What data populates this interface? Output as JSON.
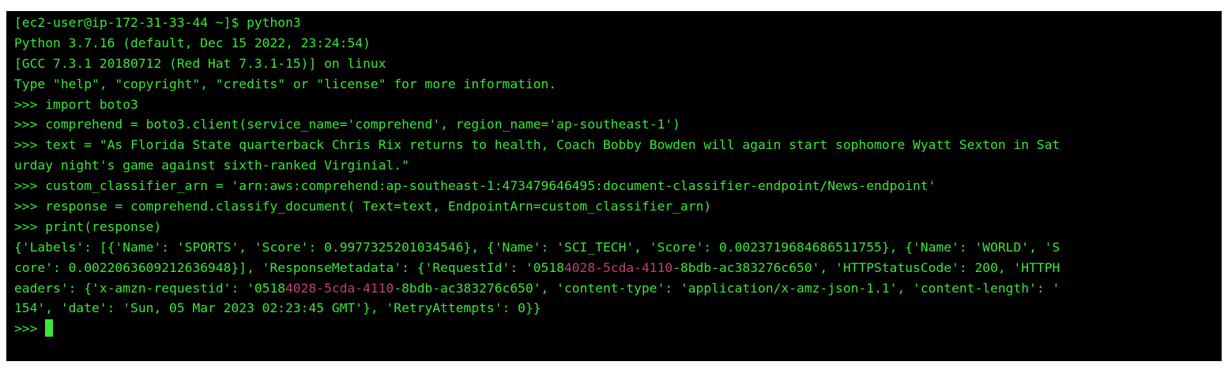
{
  "terminal": {
    "lines": [
      "[ec2-user@ip-172-31-33-44 ~]$ python3",
      "Python 3.7.16 (default, Dec 15 2022, 23:24:54)",
      "[GCC 7.3.1 20180712 (Red Hat 7.3.1-15)] on linux",
      "Type \"help\", \"copyright\", \"credits\" or \"license\" for more information.",
      ">>> import boto3",
      ">>> comprehend = boto3.client(service_name='comprehend', region_name='ap-southeast-1')",
      ">>> text = \"As Florida State quarterback Chris Rix returns to health, Coach Bobby Bowden will again start sophomore Wyatt Sexton in Sat",
      "urday night's game against sixth-ranked Virginial.\"",
      ">>> custom_classifier_arn = 'arn:aws:comprehend:ap-southeast-1:473479646495:document-classifier-endpoint/News-endpoint'",
      ">>> response = comprehend.classify_document( Text=text, EndpointArn=custom_classifier_arn)",
      ">>> print(response)",
      "{'Labels': [{'Name': 'SPORTS', 'Score': 0.9977325201034546}, {'Name': 'SCI_TECH', 'Score': 0.0023719684686511755}, {'Name': 'WORLD', 'S"
    ],
    "output_line_2": {
      "part1": "core': 0.0022063609212636948}], 'ResponseMetadata': {'RequestId': '0518",
      "pink": "4028-5cda-4110",
      "part2": "-8bdb-ac383276c650', 'HTTPStatusCode': 200, 'HTTPH"
    },
    "output_line_3": {
      "part1": "eaders': {'x-amzn-requestid': '0518",
      "pink": "4028-5cda-4110",
      "part2": "-8bdb-ac383276c650', 'content-type': 'application/x-amz-json-1.1', 'content-length': '"
    },
    "output_line_4": "154', 'date': 'Sun, 05 Mar 2023 02:23:45 GMT'}, 'RetryAttempts': 0}}",
    "prompt": ">>> ",
    "colors": {
      "background": "#000000",
      "text": "#39e639",
      "highlight": "#c0407a"
    }
  }
}
